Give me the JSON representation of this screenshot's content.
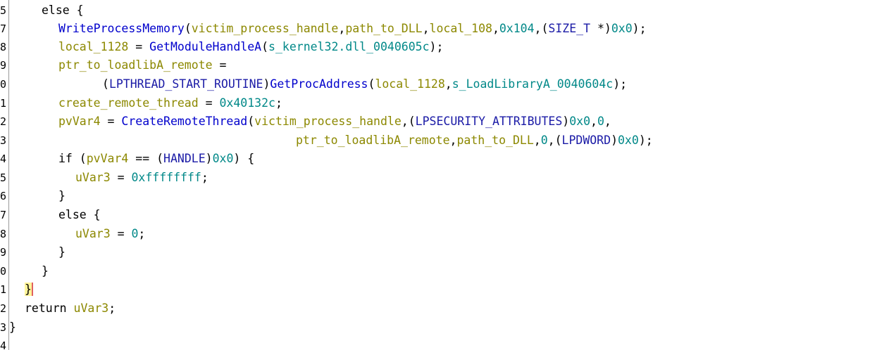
{
  "colors": {
    "keyword": "#000000",
    "function": "#0000cc",
    "variable": "#8c8800",
    "number": "#008888",
    "type": "#1a1aa6",
    "brace_highlight": "#fff59a"
  },
  "line_numbers": [
    "5",
    "7",
    "8",
    "9",
    "0",
    "1",
    "2",
    "3",
    "4",
    "5",
    "6",
    "7",
    "8",
    "9",
    "0",
    "1",
    "2",
    "3",
    "4"
  ],
  "tokens": {
    "l0": [
      "else {"
    ],
    "l1": [
      "WriteProcessMemory",
      "(",
      "victim_process_handle",
      ",",
      "path_to_DLL",
      ",",
      "local_108",
      ",",
      "0x104",
      ",(",
      "SIZE_T",
      " *)",
      "0x0",
      ");"
    ],
    "l2": [
      "local_1128",
      " = ",
      "GetModuleHandleA",
      "(",
      "s_kernel32.dll_0040605c",
      ");"
    ],
    "l3": [
      "ptr_to_loadlibA_remote",
      " ="
    ],
    "l4": [
      "(",
      "LPTHREAD_START_ROUTINE",
      ")",
      "GetProcAddress",
      "(",
      "local_1128",
      ",",
      "s_LoadLibraryA_0040604c",
      ");"
    ],
    "l5": [
      "create_remote_thread",
      " = ",
      "0x40132c",
      ";"
    ],
    "l6": [
      "pvVar4",
      " = ",
      "CreateRemoteThread",
      "(",
      "victim_process_handle",
      ",(",
      "LPSECURITY_ATTRIBUTES",
      ")",
      "0x0",
      ",",
      "0",
      ","
    ],
    "l7": [
      "ptr_to_loadlibA_remote",
      ",",
      "path_to_DLL",
      ",",
      "0",
      ",(",
      "LPDWORD",
      ")",
      "0x0",
      ");"
    ],
    "l8": [
      "if (",
      "pvVar4",
      " == (",
      "HANDLE",
      ")",
      "0x0",
      ") {"
    ],
    "l9": [
      "uVar3",
      " = ",
      "0xffffffff",
      ";"
    ],
    "l10": [
      "}"
    ],
    "l11": [
      "else {"
    ],
    "l12": [
      "uVar3",
      " = ",
      "0",
      ";"
    ],
    "l13": [
      "}"
    ],
    "l14": [
      "}"
    ],
    "l15": [
      "}"
    ],
    "l16": [
      "return ",
      "uVar3",
      ";"
    ],
    "l17": [
      "}"
    ]
  }
}
